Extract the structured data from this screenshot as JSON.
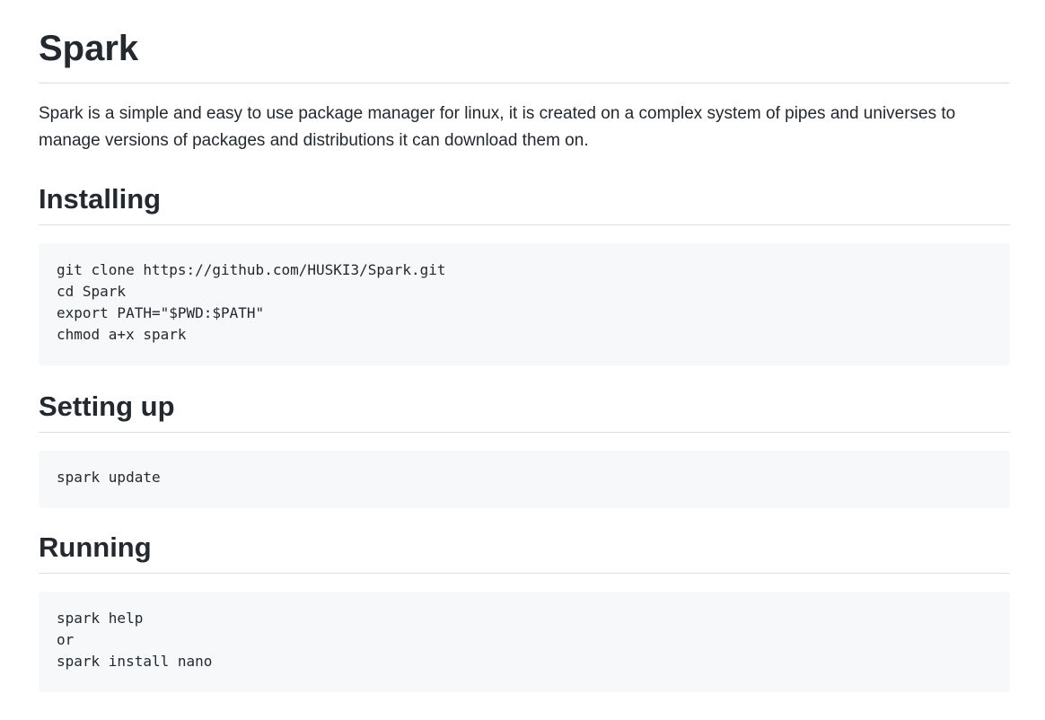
{
  "title": "Spark",
  "intro": "Spark is a simple and easy to use package manager for linux, it is created on a complex system of pipes and universes to manage versions of packages and distributions it can download them on.",
  "sections": [
    {
      "heading": "Installing",
      "code": [
        "git clone https://github.com/HUSKI3/Spark.git",
        "cd Spark",
        "export PATH=\"$PWD:$PATH\"",
        "chmod a+x spark"
      ]
    },
    {
      "heading": "Setting up",
      "code": [
        "spark update"
      ]
    },
    {
      "heading": "Running",
      "code": [
        "spark help",
        "or",
        "spark install nano"
      ]
    }
  ]
}
